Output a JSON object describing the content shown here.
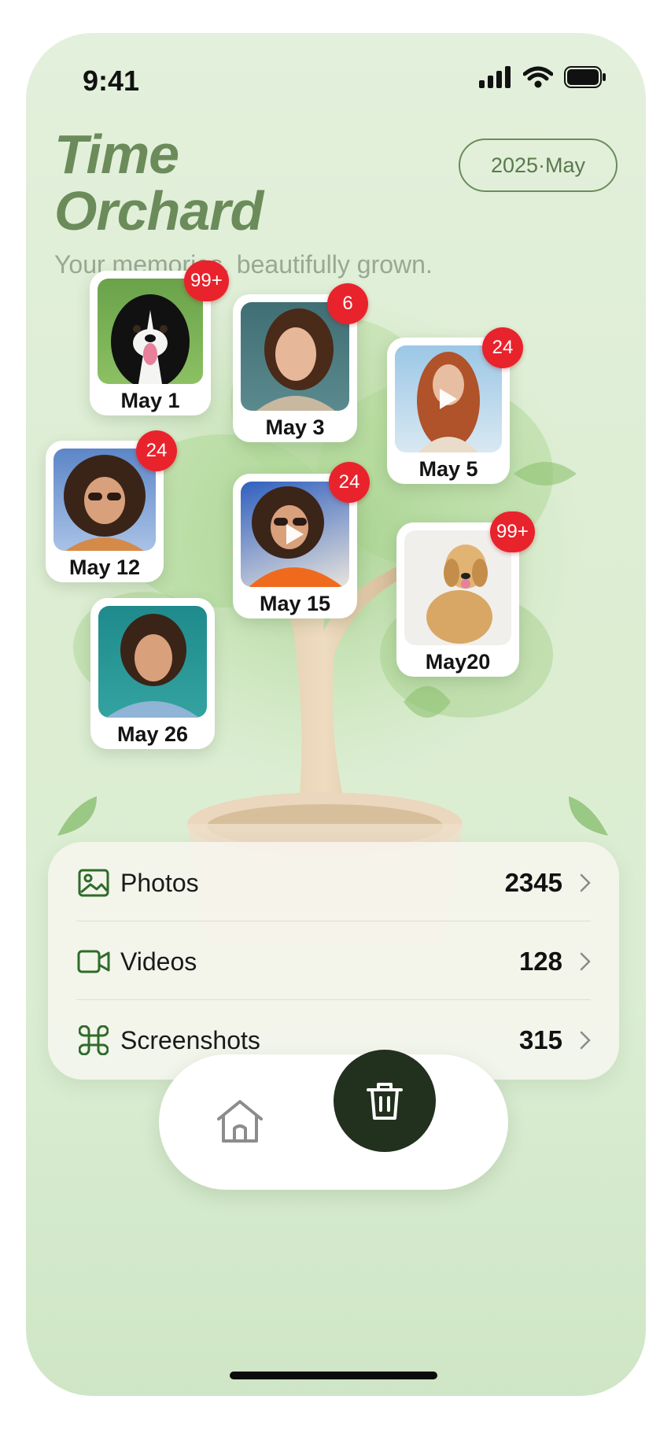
{
  "status": {
    "time": "9:41"
  },
  "header": {
    "title_line1": "Time",
    "title_line2": "Orchard",
    "subtitle": "Your memories, beautifully grown.",
    "date_pill": "2025·May"
  },
  "memories": [
    {
      "label": "May 1",
      "badge": "99+",
      "type": "photo",
      "subject": "dog-border-collie"
    },
    {
      "label": "May 3",
      "badge": "6",
      "type": "photo",
      "subject": "woman-portrait"
    },
    {
      "label": "May 5",
      "badge": "24",
      "type": "video",
      "subject": "woman-red-hair"
    },
    {
      "label": "May 12",
      "badge": "24",
      "type": "photo",
      "subject": "woman-curly-sunglasses"
    },
    {
      "label": "May 15",
      "badge": "24",
      "type": "video",
      "subject": "woman-orange-jacket"
    },
    {
      "label": "May20",
      "badge": "99+",
      "type": "photo",
      "subject": "dog-golden-retriever"
    },
    {
      "label": "May 26",
      "badge": "",
      "type": "photo",
      "subject": "woman-teal-background"
    }
  ],
  "library": {
    "rows": [
      {
        "label": "Photos",
        "count": "2345",
        "icon": "image-icon"
      },
      {
        "label": "Videos",
        "count": "128",
        "icon": "video-icon"
      },
      {
        "label": "Screenshots",
        "count": "315",
        "icon": "command-icon"
      }
    ]
  },
  "nav": {
    "items": [
      {
        "icon": "home-icon"
      },
      {
        "icon": "trash-icon"
      }
    ]
  },
  "colors": {
    "accent": "#6b8c5a",
    "badge": "#e8232c",
    "nav_active": "#22301e",
    "icon_green": "#2f6b2a"
  }
}
